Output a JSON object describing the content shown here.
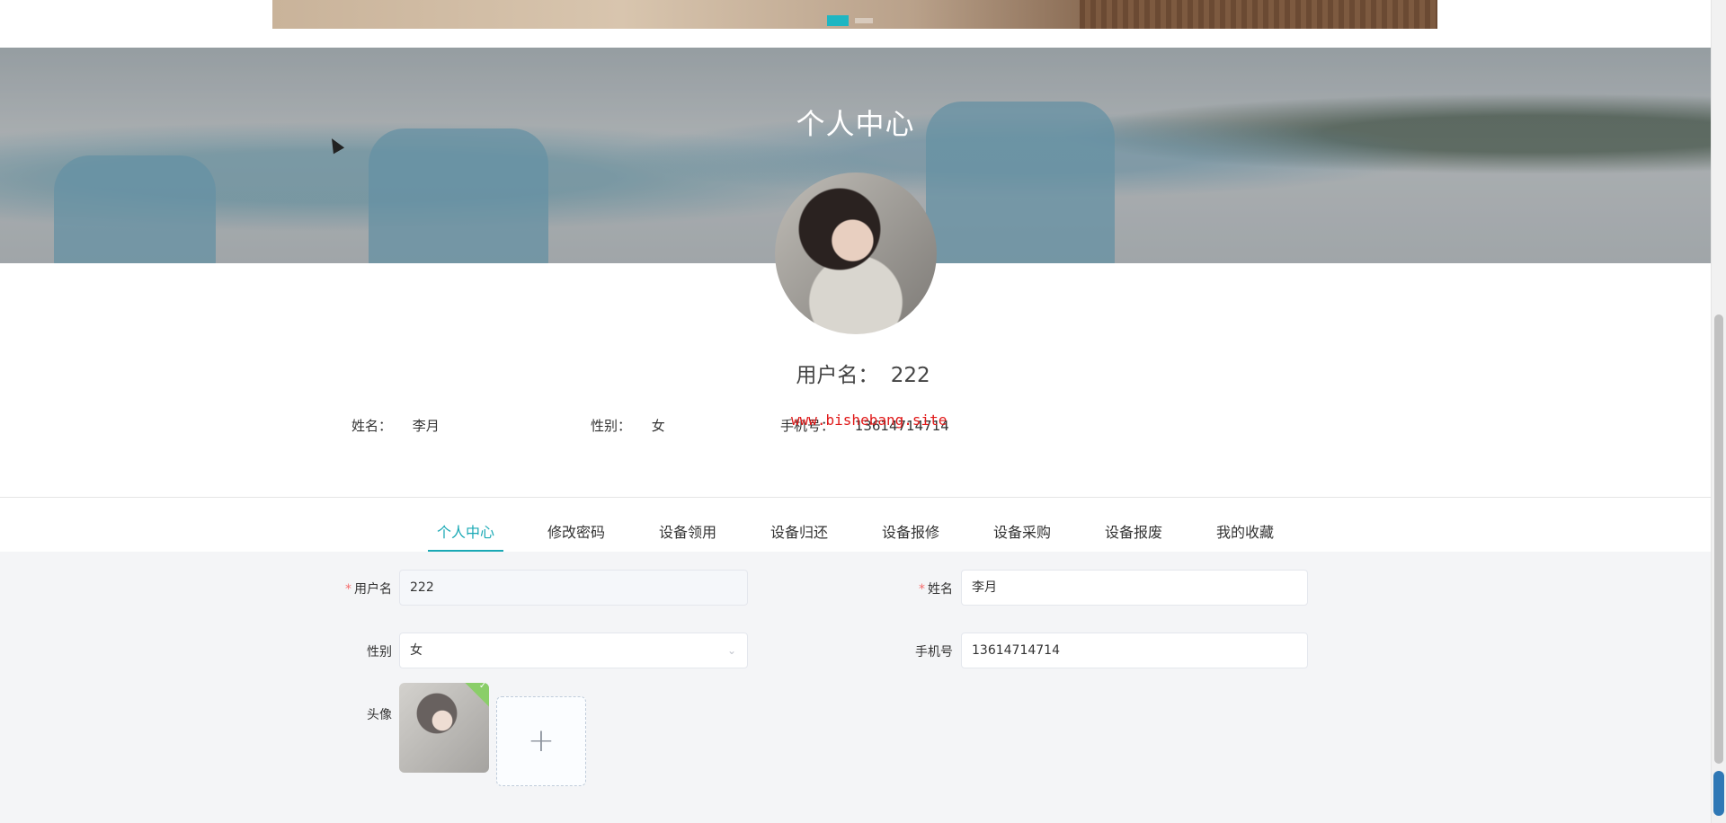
{
  "hero": {
    "title": "个人中心"
  },
  "profile": {
    "username_label": "用户名：",
    "username_value": "222",
    "name_label": "姓名：",
    "name_value": "李月",
    "gender_label": "性别：",
    "gender_value": "女",
    "phone_label": "手机号：",
    "phone_value": "13614714714"
  },
  "watermark": "www.bishebang.site",
  "tabs": [
    {
      "label": "个人中心",
      "active": true
    },
    {
      "label": "修改密码"
    },
    {
      "label": "设备领用"
    },
    {
      "label": "设备归还"
    },
    {
      "label": "设备报修"
    },
    {
      "label": "设备采购"
    },
    {
      "label": "设备报废"
    },
    {
      "label": "我的收藏"
    }
  ],
  "form": {
    "username_label": "用户名",
    "username_value": "222",
    "name_label": "姓名",
    "name_value": "李月",
    "gender_label": "性别",
    "gender_value": "女",
    "phone_label": "手机号",
    "phone_value": "13614714714",
    "avatar_label": "头像",
    "required_mark": "*",
    "upload_plus": "+"
  },
  "colors": {
    "accent": "#1aa9b5",
    "required": "#f56c6c",
    "watermark": "#e01919"
  },
  "icons": {
    "chevron": "chevron-down-icon",
    "plus": "plus-icon",
    "check": "check-icon"
  }
}
